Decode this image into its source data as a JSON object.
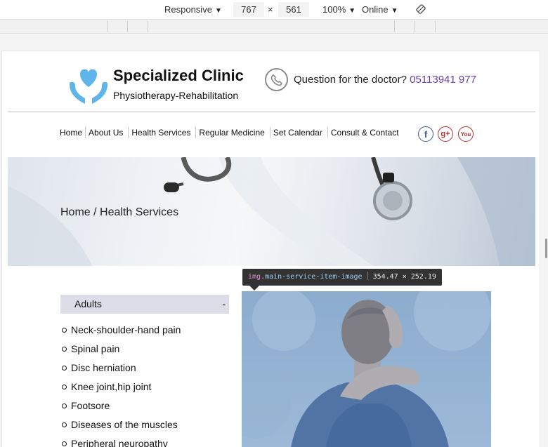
{
  "devtools": {
    "device": "Responsive",
    "width": "767",
    "times": "×",
    "height": "561",
    "zoom": "100%",
    "network": "Online",
    "inspect_tooltip": {
      "tag": "img",
      "class": ".main-service-item-image",
      "size": "354.47 × 252.19"
    }
  },
  "header": {
    "title": "Specialized Clinic",
    "subtitle": "Physiotherapy-Rehabilitation",
    "question_label": "Question for the doctor?",
    "phone": "05113941 977"
  },
  "nav": {
    "items": [
      "Home",
      "About Us",
      "Health Services",
      "Regular Medicine",
      "Set Calendar",
      "Consult & Contact"
    ]
  },
  "social": {
    "facebook": "f",
    "googleplus": "g+",
    "youtube": "You"
  },
  "hero": {
    "breadcrumb": "Home / Health Services"
  },
  "sidebar": {
    "heading": "Adults",
    "toggle": "-",
    "items": [
      "Neck-shoulder-hand pain",
      "Spinal pain",
      "Disc herniation",
      "Knee joint,hip joint",
      "Footsore",
      "Diseases of the muscles",
      "Peripheral neuropathy"
    ]
  },
  "colors": {
    "accent_purple": "#6a3fa0",
    "logo_blue": "#5fb4ea",
    "sidebar_header_bg": "#dddde9"
  }
}
